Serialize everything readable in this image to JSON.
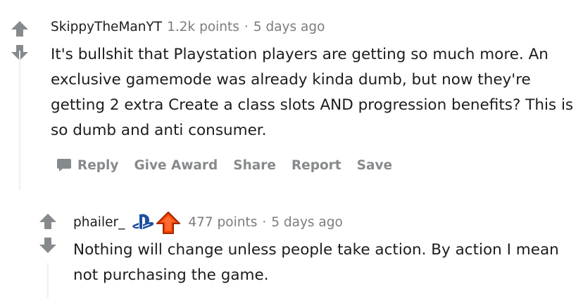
{
  "comments": [
    {
      "author": "SkippyTheManYT",
      "points": "1.2k points",
      "separator": "·",
      "time": "5 days ago",
      "body": "It's bullshit that Playstation players are getting so much more. An exclusive gamemode was already kinda dumb, but now they're getting 2 extra Create a class slots AND progression benefits? This is so dumb and anti consumer.",
      "actions": [
        "Reply",
        "Give Award",
        "Share",
        "Report",
        "Save"
      ]
    },
    {
      "author": "phailer_",
      "flair_icons": [
        "playstation-icon",
        "upvote-flair-icon"
      ],
      "points": "477 points",
      "separator": "·",
      "time": "5 days ago",
      "body": "Nothing will change unless people take action. By action I mean not purchasing the game."
    }
  ],
  "colors": {
    "vote_arrow": "#878a8c",
    "meta_gray": "#7c7c7c",
    "text": "#1c1c1c",
    "thread_line": "#edeff1",
    "playstation_blue": "#1e4fa0",
    "upvote_orange": "#ff4500"
  }
}
